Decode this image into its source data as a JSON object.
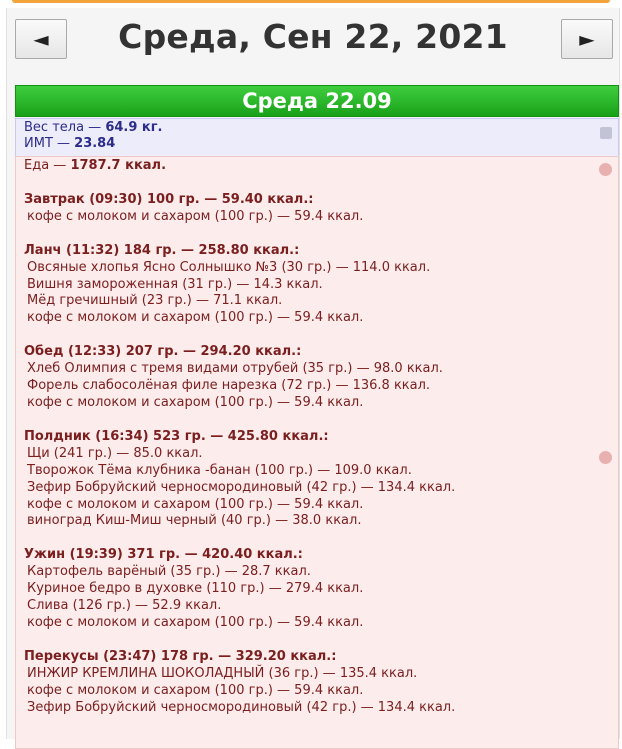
{
  "nav": {
    "prev_label": "◄",
    "next_label": "►",
    "date_title": "Среда, Сен 22, 2021"
  },
  "day_header": "Среда 22.09",
  "body_stats": {
    "weight_label": "Вес тела — ",
    "weight_value": "64.9 кг.",
    "bmi_label": "ИМТ — ",
    "bmi_value": "23.84"
  },
  "food": {
    "total_label": "Еда — ",
    "total_value": "1787.7 ккал.",
    "meals": [
      {
        "header": "Завтрак (09:30) 100 гр. — 59.40 ккал.:",
        "items": [
          "кофе с молоком и сахаром (100 гр.) — 59.4 ккал."
        ]
      },
      {
        "header": "Ланч (11:32) 184 гр. — 258.80 ккал.:",
        "items": [
          "Овсяные хлопья Ясно Солнышко №3 (30 гр.) — 114.0 ккал.",
          "Вишня замороженная (31 гр.) — 14.3 ккал.",
          "Мёд гречишный (23 гр.) — 71.1 ккал.",
          "кофе с молоком и сахаром (100 гр.) — 59.4 ккал."
        ]
      },
      {
        "header": "Обед (12:33) 207 гр. — 294.20 ккал.:",
        "items": [
          "Хлеб Олимпия с тремя видами отрубей (35 гр.) — 98.0 ккал.",
          "Форель слабосолёная филе нарезка (72 гр.) — 136.8 ккал.",
          "кофе с молоком и сахаром (100 гр.) — 59.4 ккал."
        ]
      },
      {
        "header": "Полдник (16:34) 523 гр. — 425.80 ккал.:",
        "items": [
          "Щи (241 гр.) — 85.0 ккал.",
          "Творожок Тёма клубника -банан (100 гр.) — 109.0 ккал.",
          "Зефир Бобруйский черносмородиновый (42 гр.) — 134.4 ккал.",
          "кофе с молоком и сахаром (100 гр.) — 59.4 ккал.",
          "виноград Киш-Миш черный (40 гр.) — 38.0 ккал."
        ]
      },
      {
        "header": "Ужин (19:39) 371 гр. — 420.40 ккал.:",
        "items": [
          "Картофель варёный (35 гр.) — 28.7 ккал.",
          "Куриное бедро в духовке (110 гр.) — 279.4 ккал.",
          "Слива (126 гр.) — 52.9 ккал.",
          "кофе с молоком и сахаром (100 гр.) — 59.4 ккал."
        ]
      },
      {
        "header": "Перекусы (23:47) 178 гр. — 329.20 ккал.:",
        "items": [
          "ИНЖИР КРЕМЛИНА ШОКОЛАДНЫЙ (36 гр.) — 135.4 ккал.",
          "кофе с молоком и сахаром (100 гр.) — 59.4 ккал.",
          "Зефир Бобруйский черносмородиновый (42 гр.) — 134.4 ккал."
        ]
      }
    ]
  },
  "colors": {
    "header_green": "#19a119",
    "weight_bg": "#ececfb",
    "food_bg": "#fdecec",
    "food_text": "#7a1e1e",
    "weight_text": "#2c2c8a"
  },
  "icons": {
    "weight": "scale-icon",
    "food": "apple-icon"
  }
}
